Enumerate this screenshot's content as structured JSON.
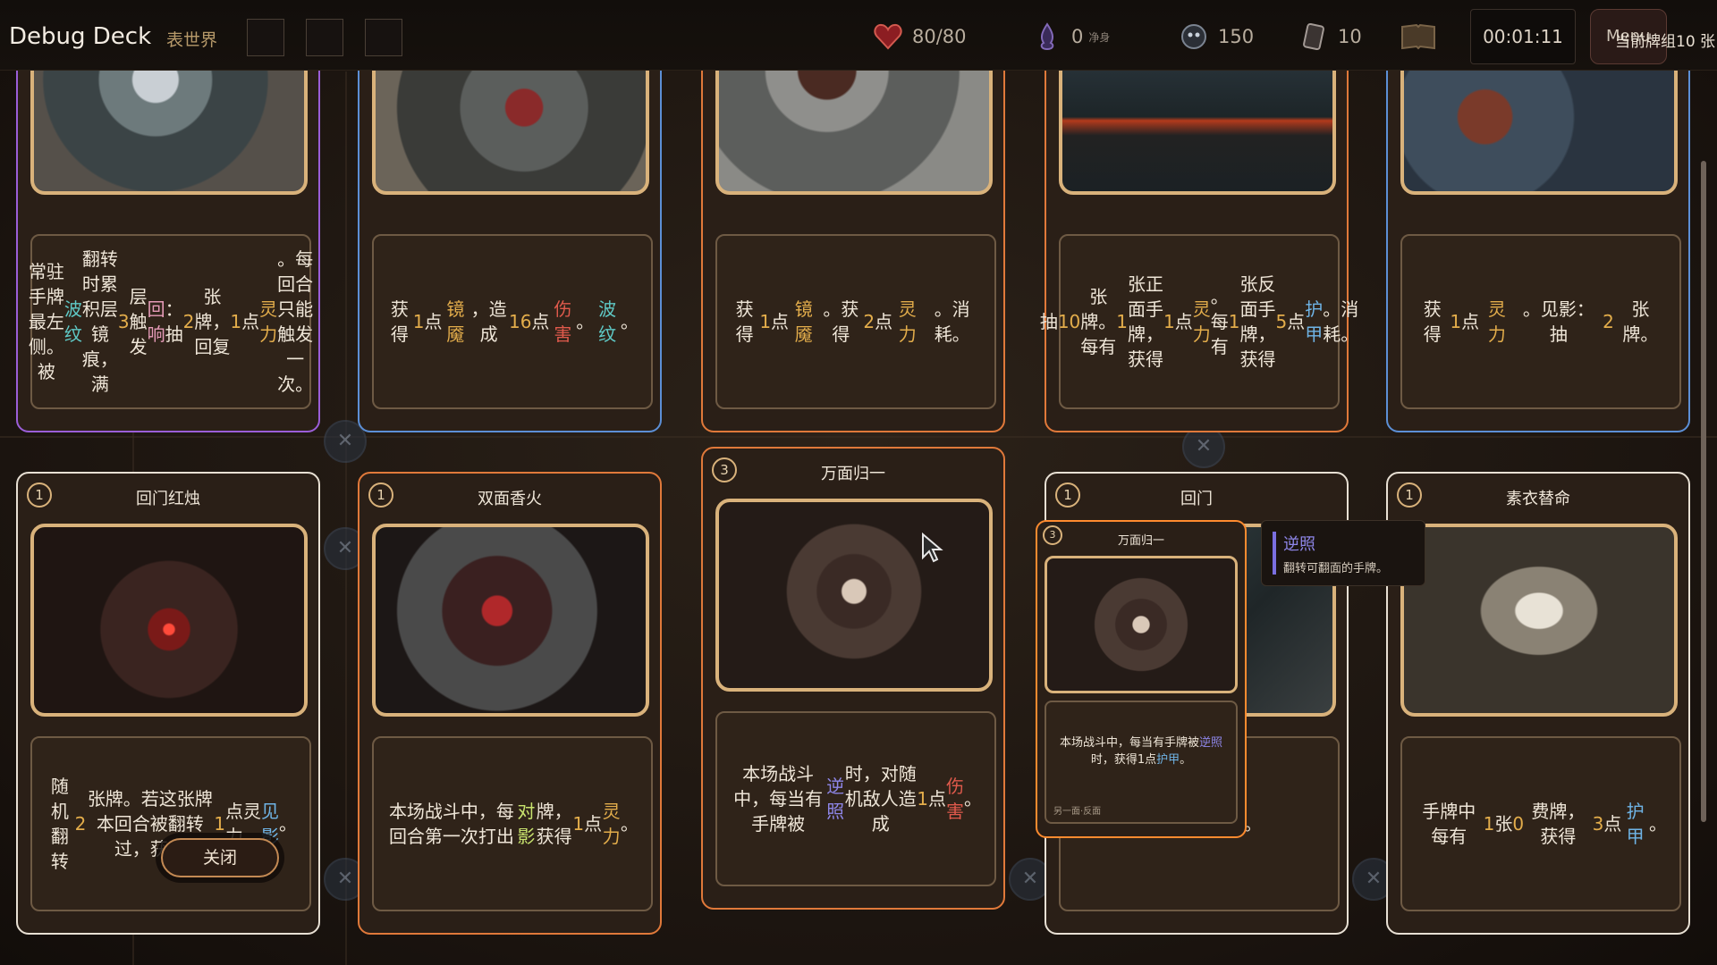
{
  "topbar": {
    "title": "Debug Deck",
    "world": "表世界",
    "hp": "80/80",
    "purify_count": "0",
    "purify_label": "净身",
    "souls": "150",
    "cards_count": "10",
    "timer": "00:01:11",
    "menu_label": "Menu",
    "deck_count": "当前牌组10 张"
  },
  "cards_top": [
    {
      "border": "#9b5ed8",
      "desc_html": "常驻手牌最左侧。被<span class='hl-teal'>波纹</span>翻转时累积层镜痕，满<span class='hl-gold'>3</span>层触发<span class='hl-pink'>回响</span>：抽<span class='hl-gold'>2</span>张牌，回复<span class='hl-gold'>1</span>点<span class='hl-gold'>灵力</span>。每回合只能触发一次。"
    },
    {
      "border": "#5c8fd6",
      "desc_html": "获得<span class='hl-gold'>1</span>点<span class='hl-gold'>镜魇</span>，造成<span class='hl-gold'>16</span>点<span class='hl-red'>伤害</span>。<span class='hl-teal'>波纹</span>。"
    },
    {
      "border": "#e0793a",
      "desc_html": "获得<span class='hl-gold'>1</span>点<span class='hl-gold'>镜魇</span>。获得<span class='hl-gold'>2</span>点<span class='hl-gold'>灵力</span>。消耗。"
    },
    {
      "border": "#e0793a",
      "desc_html": "抽<span class='hl-gold'>10</span>张牌。每有<span class='hl-gold'>1</span>张正面手牌，获得<span class='hl-gold'>1</span>点<span class='hl-gold'>灵力</span>。每有<span class='hl-gold'>1</span>张反面手牌，获得<span class='hl-gold'>5</span>点<span class='hl-blue'>护甲</span>。消耗。"
    },
    {
      "border": "#5c8fd6",
      "desc_html": "获得<span class='hl-gold'>1</span>点<span class='hl-gold'>灵力</span>。见影：抽<span class='hl-gold'>2</span>张牌。"
    }
  ],
  "cards_bottom": [
    {
      "cost": "1",
      "name": "回门红烛",
      "border": "#e8e0d4",
      "desc_html": "随机翻转<span class='hl-gold'>2</span>张牌。若这张牌本回合被翻转过，获得<span class='hl-gold'>1</span>点灵力。<span class='hl-blue'>见影</span>。"
    },
    {
      "cost": "1",
      "name": "双面香火",
      "border": "#e0793a",
      "desc_html": "本场战斗中，每回合第一次打出<span class='hl-lime'>对影</span>牌，获得<span class='hl-gold'>1</span>点<span class='hl-gold'>灵力</span>。"
    },
    {
      "cost": "3",
      "name": "万面归一",
      "border": "#e0793a",
      "desc_html": "本场战斗中，每当有手牌被<span class='hl-violet'>逆照</span>时，对随机敌人造成<span class='hl-gold'>1</span>点<span class='hl-red'>伤害</span>。"
    },
    {
      "cost": "1",
      "name": "回门",
      "border": "#e8e0d4",
      "desc_html": "随机翻转一次。"
    },
    {
      "cost": "1",
      "name": "素衣替命",
      "border": "#e8e0d4",
      "desc_html": "手牌中每有<span class='hl-gold'>1</span>张<span class='hl-gold'>0</span>费牌，获得<span class='hl-gold'>3</span>点<span class='hl-blue'>护甲</span>。"
    }
  ],
  "preview": {
    "cost": "3",
    "name": "万面归一",
    "desc_html": "本场战斗中，每当有手牌被<span class='hl-violet'>逆照</span>时，获得1点<span class='hl-blue'>护甲</span>。",
    "footer": "另一面·反面"
  },
  "tooltip": {
    "title": "逆照",
    "body": "翻转可翻面的手牌。"
  },
  "close_label": "关闭",
  "colors": {
    "gold": "#d9b27b",
    "orange": "#e0793a",
    "blue": "#5c8fd6",
    "violet": "#9b5ed8"
  }
}
